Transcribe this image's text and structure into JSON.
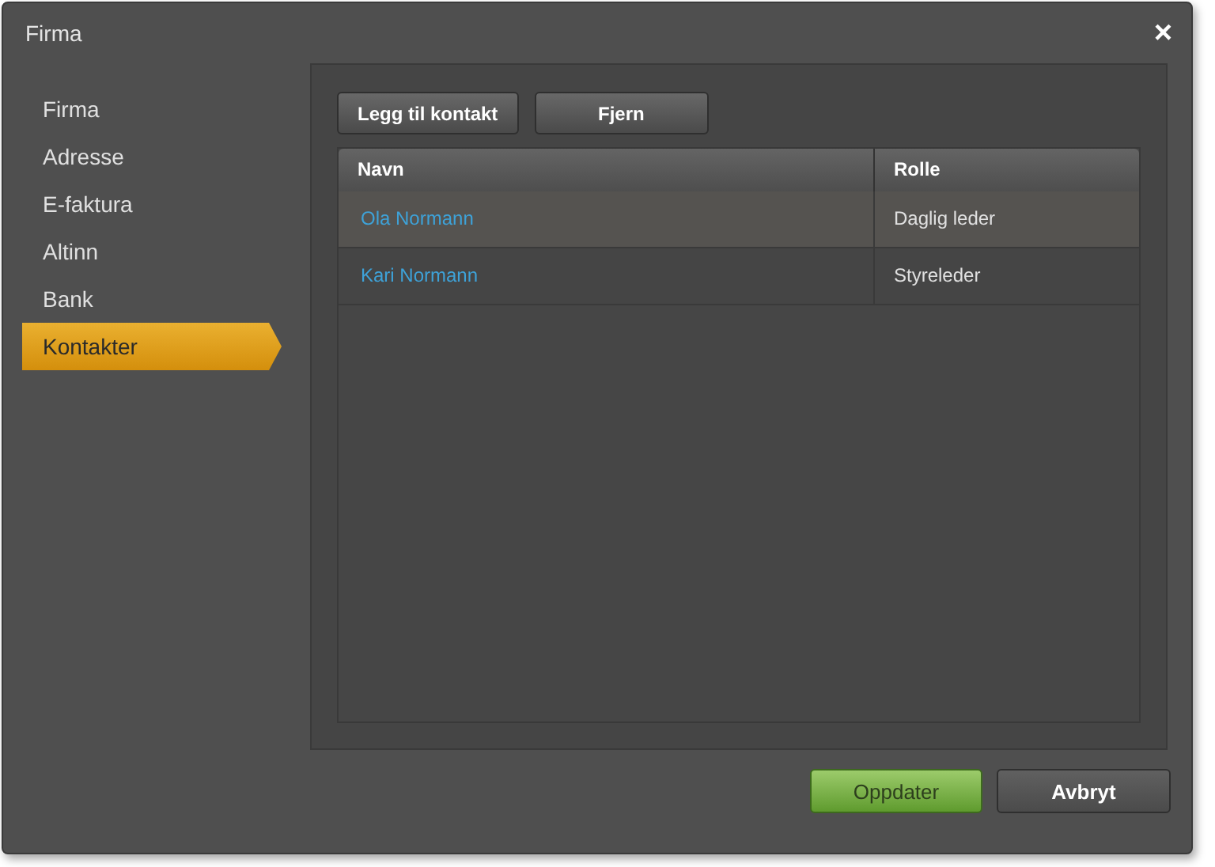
{
  "window": {
    "title": "Firma",
    "close": "×"
  },
  "sidebar": {
    "items": [
      {
        "label": "Firma",
        "selected": false
      },
      {
        "label": "Adresse",
        "selected": false
      },
      {
        "label": "E-faktura",
        "selected": false
      },
      {
        "label": "Altinn",
        "selected": false
      },
      {
        "label": "Bank",
        "selected": false
      },
      {
        "label": "Kontakter",
        "selected": true
      }
    ]
  },
  "toolbar": [
    "Legg til kontakt",
    "Fjern"
  ],
  "table": {
    "columns": [
      "Navn",
      "Rolle"
    ],
    "rows": [
      {
        "name": "Ola Normann",
        "role": "Daglig leder",
        "selected": true
      },
      {
        "name": "Kari Normann",
        "role": "Styreleder",
        "selected": false
      }
    ]
  },
  "buttons": [
    {
      "label": "Oppdater",
      "kind": "primary"
    },
    {
      "label": "Avbryt",
      "kind": "secondary"
    }
  ]
}
